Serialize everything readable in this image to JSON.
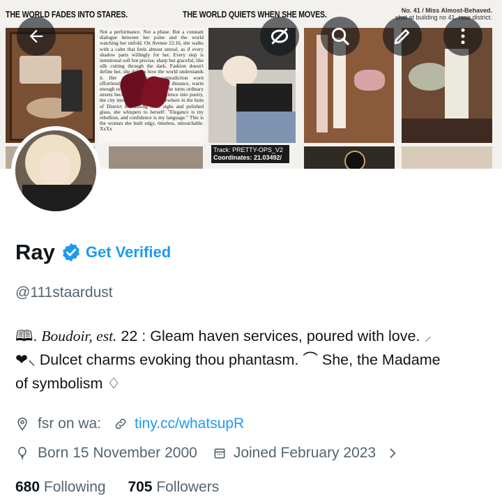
{
  "banner": {
    "caption_left": "THE WORLD FADES INTO STARES.",
    "caption_center": "THE WORLD QUIETS WHEN SHE MOVES.",
    "note_line1": "No. 41 / Miss Almost-Behaved.",
    "note_line2": "shot at building no 41, rose district.",
    "story_text": "Not a performance. Not a phase. But a constant dialogue between her pulse and the world watching her unfold. On Avenue 22:16, she walks with a calm that feels almost unreal, as if every shadow parts willingly for her. Every step is intentional soft but precise, sharp but graceful, like silk cutting through the dark. Fashion doesn't define her, she defines how the world understands it. Her aesthetic is a contradiction worn effortlessly: cold enough to keep distance, warm enough to keep eyes. Wherever she turns ordinary streets become galleries, turns silence into poetry, the city into her echo. And somewhere in the hum of District 88, among neon sighs and polished glass, she whispers to herself: \"Elegance is my rebellion, and confidence is my language.\" This is the woman she built edgy, timeless, untouchable. XxXx",
    "track_line1": "Track: PRETTY-OPS_V2",
    "track_line2": "Coordinates: 21.03492/"
  },
  "header_buttons": {
    "back": "back-arrow-icon",
    "hide": "eye-off-icon",
    "search": "search-icon",
    "edit": "pencil-icon",
    "more": "more-vertical-icon"
  },
  "profile": {
    "name": "Ray",
    "get_verified": "Get Verified",
    "handle": "@111staardust",
    "bio_line1_glyph": "🕮.",
    "bio_line1_italic": "Boudoir, est.",
    "bio_line1_rest": " 22 : Gleam haven services, poured with love.",
    "bio_line1_tail": "⸝",
    "bio_line2_glyph": "❤︎⸜",
    "bio_line2_text": " Dulcet charms evoking thou phantasm.",
    "bio_line2_glyph2": " ⌒ ",
    "bio_line2_rest": "She, the Madame",
    "bio_line3": "of symbolism ♢",
    "location": "fsr on wa:",
    "website": "tiny.cc/whatsupR",
    "birth": "Born 15 November 2000",
    "joined": "Joined February 2023",
    "following_count": "680",
    "following_label": "Following",
    "followers_count": "705",
    "followers_label": "Followers"
  },
  "colors": {
    "accent": "#1d9bf0",
    "muted": "#536471",
    "text": "#0f1419"
  }
}
